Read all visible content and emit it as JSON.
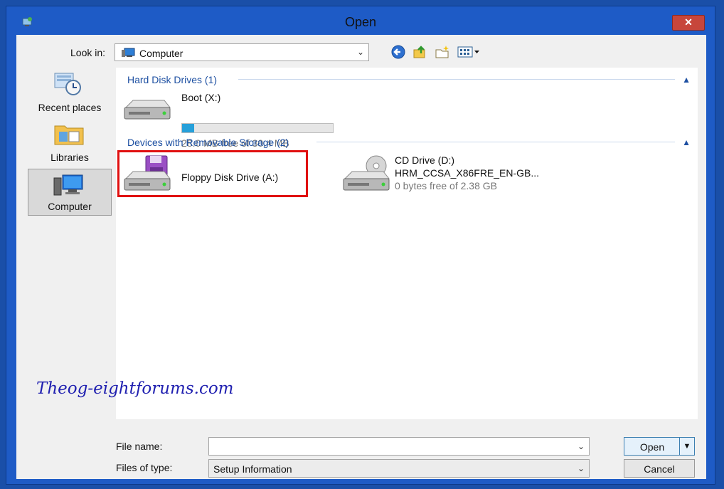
{
  "window": {
    "title": "Open",
    "close_glyph": "✕"
  },
  "toolbar": {
    "lookin_label": "Look in:",
    "lookin_value": "Computer",
    "buttons": [
      "back-icon",
      "up-folder-icon",
      "new-folder-icon",
      "view-menu-icon"
    ]
  },
  "places": [
    {
      "label": "Recent places",
      "icon": "recent-places-icon"
    },
    {
      "label": "Libraries",
      "icon": "libraries-icon"
    },
    {
      "label": "Computer",
      "icon": "computer-icon",
      "selected": true
    }
  ],
  "groups": {
    "hard_disk": {
      "header": "Hard Disk Drives (1)"
    },
    "removable": {
      "header": "Devices with Removable Storage (2)"
    }
  },
  "drives": {
    "boot": {
      "name": "Boot (X:)",
      "free": "28.0 MB free of 30.4 MB",
      "used_fraction": 0.08,
      "icon": "hard-disk-icon"
    },
    "floppy": {
      "name": "Floppy Disk Drive (A:)",
      "icon": "floppy-drive-icon"
    },
    "cd": {
      "name": "CD Drive (D:)",
      "label": "HRM_CCSA_X86FRE_EN-GB...",
      "free": "0 bytes free of 2.38 GB",
      "icon": "cd-drive-icon"
    }
  },
  "watermark": "Theog-eightforums.com",
  "bottom": {
    "file_name_label": "File name:",
    "file_name_value": "",
    "files_of_type_label": "Files of type:",
    "files_of_type_value": "Setup Information",
    "open_label": "Open",
    "cancel_label": "Cancel"
  },
  "colors": {
    "accent": "#1e50a2",
    "highlight": "#e01010",
    "progress": "#26a0da"
  }
}
